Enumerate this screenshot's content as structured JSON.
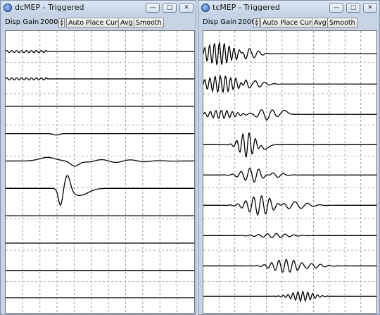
{
  "windows": [
    {
      "id": "left",
      "title": "dcMEP - Triggered",
      "toolbar": {
        "gain_label": "Disp Gain",
        "gain_value": "2000",
        "auto_place": "Auto Place Cursors",
        "avg": "Avg",
        "smooth": "Smooth"
      },
      "controls": {
        "minimize": "—",
        "restore": "□",
        "close": "✕"
      },
      "trace_count": 10
    },
    {
      "id": "right",
      "title": "tcMEP - Triggered",
      "toolbar": {
        "gain_label": "Disp Gain",
        "gain_value": "2000",
        "auto_place": "Auto Place Cursors",
        "avg": "Avg",
        "smooth": "Smooth"
      },
      "controls": {
        "minimize": "—",
        "restore": "□",
        "close": "✕"
      },
      "trace_count": 9
    }
  ]
}
